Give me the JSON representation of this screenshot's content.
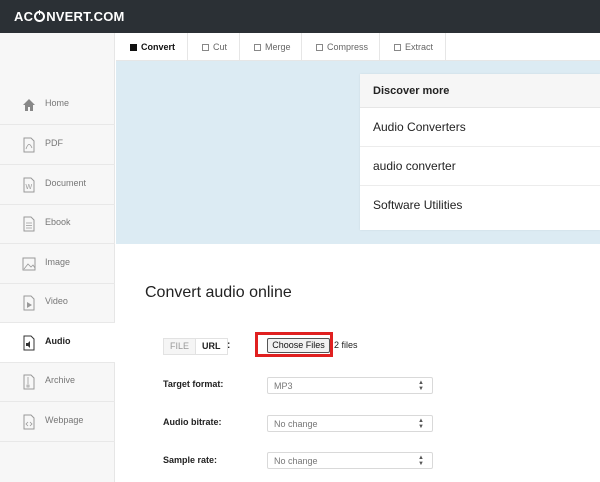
{
  "header": {
    "logo_left": "AC",
    "logo_right": "NVERT.COM"
  },
  "sidebar": {
    "items": [
      {
        "label": "Home",
        "icon": "home-icon"
      },
      {
        "label": "PDF",
        "icon": "pdf-icon"
      },
      {
        "label": "Document",
        "icon": "document-icon"
      },
      {
        "label": "Ebook",
        "icon": "ebook-icon"
      },
      {
        "label": "Image",
        "icon": "image-icon"
      },
      {
        "label": "Video",
        "icon": "video-icon"
      },
      {
        "label": "Audio",
        "icon": "audio-icon",
        "active": true
      },
      {
        "label": "Archive",
        "icon": "archive-icon"
      },
      {
        "label": "Webpage",
        "icon": "webpage-icon"
      }
    ]
  },
  "tabs": [
    {
      "label": "Convert",
      "active": true
    },
    {
      "label": "Cut"
    },
    {
      "label": "Merge"
    },
    {
      "label": "Compress"
    },
    {
      "label": "Extract"
    }
  ],
  "discover": {
    "title": "Discover more",
    "items": [
      "Audio Converters",
      "audio converter",
      "Software Utilities"
    ]
  },
  "main": {
    "title": "Convert audio online",
    "source_file": "FILE",
    "source_url": "URL",
    "colon": ":",
    "choose_files": "Choose Files",
    "files_count": "2 files",
    "fields": [
      {
        "label": "Target format:",
        "value": "MP3"
      },
      {
        "label": "Audio bitrate:",
        "value": "No change"
      },
      {
        "label": "Sample rate:",
        "value": "No change"
      }
    ]
  },
  "colors": {
    "topbar": "#2b3035",
    "banner": "#dcebf3",
    "highlight": "#e02020"
  }
}
